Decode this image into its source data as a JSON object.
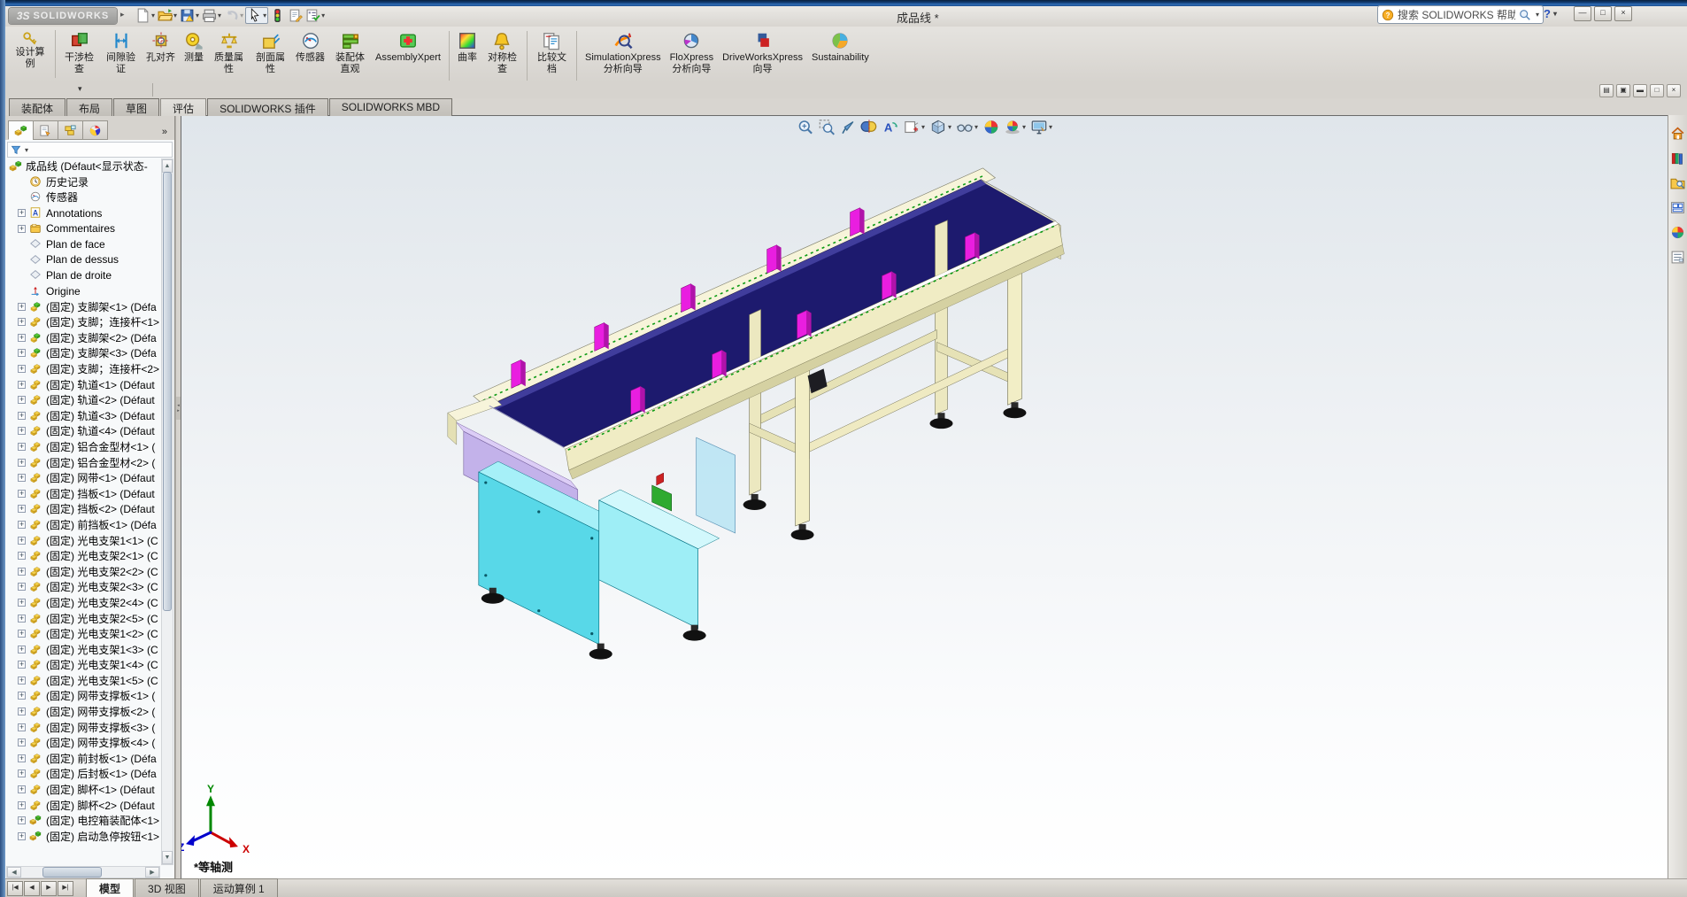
{
  "titlebar": {
    "brand_mark": "3S",
    "brand_name": "SOLIDWORKS",
    "document_title": "成品线 *",
    "search_text": "搜索 SOLIDWORKS 帮助",
    "help_label": "?",
    "quick_tools": [
      {
        "icon": "new-document",
        "dropdown": true
      },
      {
        "icon": "open-folder",
        "dropdown": true
      },
      {
        "icon": "save",
        "dropdown": true
      },
      {
        "icon": "print",
        "dropdown": true
      },
      {
        "icon": "undo",
        "dropdown": true,
        "disabled": true
      },
      {
        "icon": "select-arrow",
        "dropdown": true,
        "pressed": true
      },
      {
        "icon": "rebuild-traffic-light",
        "dropdown": false
      },
      {
        "icon": "file-properties",
        "dropdown": false
      },
      {
        "icon": "options-list",
        "dropdown": true
      }
    ],
    "window_buttons": [
      {
        "name": "minimize",
        "glyph": "—"
      },
      {
        "name": "restore",
        "glyph": "□"
      },
      {
        "name": "close",
        "glyph": "×"
      }
    ]
  },
  "ribbon": {
    "design_study": {
      "label": "设计算例",
      "icon": "design-study"
    },
    "tools": [
      {
        "label": "干涉检查",
        "icon": "interference-detection"
      },
      {
        "label": "间隙验证",
        "icon": "clearance-verification"
      },
      {
        "label": "孔对齐",
        "icon": "hole-alignment"
      },
      {
        "label": "测量",
        "icon": "measure"
      },
      {
        "label": "质量属性",
        "icon": "mass-properties"
      },
      {
        "label": "剖面属性",
        "icon": "section-properties"
      },
      {
        "label": "传感器",
        "icon": "sensor"
      },
      {
        "label": "装配体直观",
        "icon": "assembly-visualization"
      },
      {
        "label": "AssemblyXpert",
        "icon": "assembly-xpert"
      },
      {
        "sep": true
      },
      {
        "label": "曲率",
        "icon": "curvature"
      },
      {
        "label": "对称检查",
        "icon": "symmetry-check"
      },
      {
        "sep": true
      },
      {
        "label": "比较文档",
        "icon": "compare-documents"
      },
      {
        "sep": true
      },
      {
        "label": "SimulationXpress\n分析向导",
        "icon": "simulationxpress"
      },
      {
        "label": "FloXpress\n分析向导",
        "icon": "floxpress"
      },
      {
        "label": "DriveWorksXpress\n向导",
        "icon": "driveworksxpress"
      },
      {
        "label": "Sustainability",
        "icon": "sustainability"
      }
    ]
  },
  "command_tabs": [
    {
      "label": "装配体",
      "active": false
    },
    {
      "label": "布局",
      "active": false
    },
    {
      "label": "草图",
      "active": false
    },
    {
      "label": "评估",
      "active": true
    },
    {
      "label": "SOLIDWORKS 插件",
      "active": false
    },
    {
      "label": "SOLIDWORKS MBD",
      "active": false
    }
  ],
  "mdi_controls": [
    {
      "name": "cascade",
      "glyph": "▤"
    },
    {
      "name": "tile",
      "glyph": "▣"
    },
    {
      "name": "minimize",
      "glyph": "▬"
    },
    {
      "name": "restore",
      "glyph": "□"
    },
    {
      "name": "close",
      "glyph": "×"
    }
  ],
  "feature_panel": {
    "tabs": [
      {
        "icon": "featuremanager-tab",
        "active": true
      },
      {
        "icon": "propertymanager-tab",
        "active": false
      },
      {
        "icon": "configurationmanager-tab",
        "active": false
      },
      {
        "icon": "displaymanager-tab",
        "active": false
      }
    ],
    "overflow": "»",
    "tree": [
      {
        "label": "成品线 (Défaut<显示状态-",
        "icon": "assembly-root",
        "exp": false,
        "root": true
      },
      {
        "label": "历史记录",
        "icon": "history",
        "exp": false
      },
      {
        "label": "传感器",
        "icon": "sensors",
        "exp": false
      },
      {
        "label": "Annotations",
        "icon": "annotations",
        "exp": true
      },
      {
        "label": "Commentaires",
        "icon": "comments",
        "exp": true
      },
      {
        "label": "Plan de face",
        "icon": "plane",
        "exp": false
      },
      {
        "label": "Plan de dessus",
        "icon": "plane",
        "exp": false
      },
      {
        "label": "Plan de droite",
        "icon": "plane",
        "exp": false
      },
      {
        "label": "Origine",
        "icon": "origin",
        "exp": false
      },
      {
        "label": "(固定) 支脚架<1> (Défa",
        "icon": "part-green",
        "exp": true
      },
      {
        "label": "(固定) 支脚；连接杆<1>",
        "icon": "part",
        "exp": true
      },
      {
        "label": "(固定) 支脚架<2> (Défa",
        "icon": "part-green",
        "exp": true
      },
      {
        "label": "(固定) 支脚架<3> (Défa",
        "icon": "part-green",
        "exp": true
      },
      {
        "label": "(固定) 支脚；连接杆<2>",
        "icon": "part",
        "exp": true
      },
      {
        "label": "(固定) 轨道<1> (Défaut",
        "icon": "part",
        "exp": true
      },
      {
        "label": "(固定) 轨道<2> (Défaut",
        "icon": "part",
        "exp": true
      },
      {
        "label": "(固定) 轨道<3> (Défaut",
        "icon": "part",
        "exp": true
      },
      {
        "label": "(固定) 轨道<4> (Défaut",
        "icon": "part",
        "exp": true
      },
      {
        "label": "(固定) 铝合金型材<1> (",
        "icon": "part",
        "exp": true
      },
      {
        "label": "(固定) 铝合金型材<2> (",
        "icon": "part",
        "exp": true
      },
      {
        "label": "(固定) 网带<1> (Défaut",
        "icon": "part",
        "exp": true
      },
      {
        "label": "(固定) 挡板<1> (Défaut",
        "icon": "part",
        "exp": true
      },
      {
        "label": "(固定) 挡板<2> (Défaut",
        "icon": "part",
        "exp": true
      },
      {
        "label": "(固定) 前挡板<1> (Défa",
        "icon": "part",
        "exp": true
      },
      {
        "label": "(固定) 光电支架1<1> (C",
        "icon": "part",
        "exp": true
      },
      {
        "label": "(固定) 光电支架2<1> (C",
        "icon": "part",
        "exp": true
      },
      {
        "label": "(固定) 光电支架2<2> (C",
        "icon": "part",
        "exp": true
      },
      {
        "label": "(固定) 光电支架2<3> (C",
        "icon": "part",
        "exp": true
      },
      {
        "label": "(固定) 光电支架2<4> (C",
        "icon": "part",
        "exp": true
      },
      {
        "label": "(固定) 光电支架2<5> (C",
        "icon": "part",
        "exp": true
      },
      {
        "label": "(固定) 光电支架1<2> (C",
        "icon": "part",
        "exp": true
      },
      {
        "label": "(固定) 光电支架1<3> (C",
        "icon": "part",
        "exp": true
      },
      {
        "label": "(固定) 光电支架1<4> (C",
        "icon": "part",
        "exp": true
      },
      {
        "label": "(固定) 光电支架1<5> (C",
        "icon": "part",
        "exp": true
      },
      {
        "label": "(固定) 网带支撑板<1> (",
        "icon": "part",
        "exp": true
      },
      {
        "label": "(固定) 网带支撑板<2> (",
        "icon": "part",
        "exp": true
      },
      {
        "label": "(固定) 网带支撑板<3> (",
        "icon": "part",
        "exp": true
      },
      {
        "label": "(固定) 网带支撑板<4> (",
        "icon": "part",
        "exp": true
      },
      {
        "label": "(固定) 前封板<1> (Défa",
        "icon": "part",
        "exp": true
      },
      {
        "label": "(固定) 后封板<1> (Défa",
        "icon": "part",
        "exp": true
      },
      {
        "label": "(固定) 脚杯<1> (Défaut",
        "icon": "part",
        "exp": true
      },
      {
        "label": "(固定) 脚杯<2> (Défaut",
        "icon": "part",
        "exp": true
      },
      {
        "label": "(固定) 电控箱装配体<1>",
        "icon": "assembly-part",
        "exp": true
      },
      {
        "label": "(固定) 启动急停按钮<1>",
        "icon": "assembly-part",
        "exp": true
      }
    ]
  },
  "viewport": {
    "view_label": "*等轴测",
    "triad": {
      "x": "X",
      "y": "Y",
      "z": "Z"
    },
    "headsup_tools": [
      {
        "icon": "zoom-fit",
        "dropdown": false
      },
      {
        "icon": "zoom-area",
        "dropdown": false
      },
      {
        "icon": "previous-view",
        "dropdown": false
      },
      {
        "icon": "section-view",
        "dropdown": false
      },
      {
        "icon": "annotation-views",
        "dropdown": false
      },
      {
        "icon": "view-orientation",
        "dropdown": true
      },
      {
        "icon": "display-style",
        "dropdown": true
      },
      {
        "icon": "hide-show-items",
        "dropdown": true
      },
      {
        "icon": "edit-appearance",
        "dropdown": false
      },
      {
        "icon": "apply-scene",
        "dropdown": true
      },
      {
        "icon": "view-settings",
        "dropdown": true
      }
    ]
  },
  "task_pane": [
    {
      "icon": "resources-home"
    },
    {
      "icon": "design-library"
    },
    {
      "icon": "file-explorer"
    },
    {
      "icon": "view-palette"
    },
    {
      "icon": "appearances"
    },
    {
      "icon": "custom-properties"
    }
  ],
  "bottom_bar": {
    "nav_buttons": [
      "|◀",
      "◀",
      "▶",
      "▶|"
    ],
    "tabs": [
      {
        "label": "模型",
        "active": true
      },
      {
        "label": "3D 视图",
        "active": false
      },
      {
        "label": "运动算例 1",
        "active": false
      }
    ]
  },
  "colors": {
    "titlebar_blue": "#1c4f8f",
    "belt_navy": "#1d1a6e",
    "frame_cream": "#f0ecc4",
    "box_cyan": "#58d8e8",
    "box_cyan_light": "#9eeef6",
    "panel_lavender": "#c3b2ea",
    "bracket_magenta": "#e91ee0",
    "plate_lightblue": "#bde6f4",
    "triad_x": "#cc0000",
    "triad_y": "#008800",
    "triad_z": "#0000cc"
  }
}
